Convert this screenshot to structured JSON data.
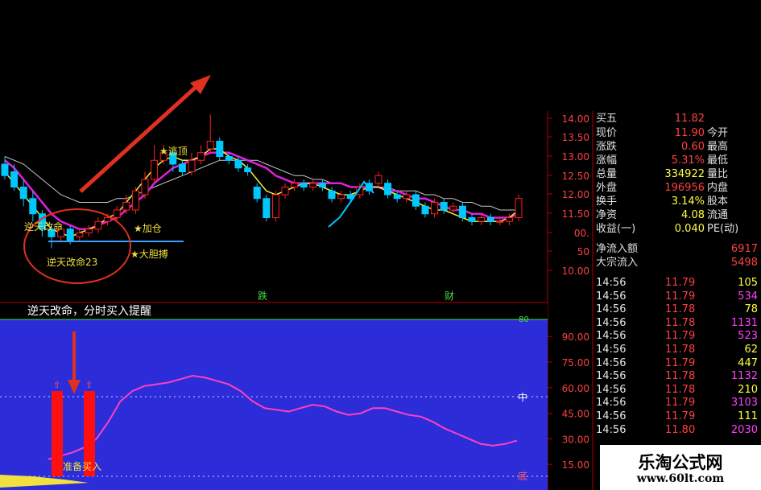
{
  "chart_data": [
    {
      "type": "candlestick",
      "ylim": [
        10.0,
        14.0
      ],
      "y_ticks": [
        "14.00",
        "13.50",
        "13.00",
        "12.50",
        "12.00",
        "11.50",
        "00.",
        "50",
        "10.00"
      ],
      "x_markers": [
        "跌",
        "财"
      ],
      "signal_labels": [
        "逆天改命",
        "逆天改命23",
        "加仓",
        "大胆搏",
        "逃顶"
      ],
      "candles": [
        {
          "o": 12.8,
          "c": 12.5,
          "h": 13.0,
          "l": 12.4
        },
        {
          "o": 12.6,
          "c": 12.2,
          "h": 12.8,
          "l": 12.1
        },
        {
          "o": 12.2,
          "c": 11.9,
          "h": 12.4,
          "l": 11.7
        },
        {
          "o": 11.9,
          "c": 11.5,
          "h": 12.1,
          "l": 11.3
        },
        {
          "o": 11.5,
          "c": 11.1,
          "h": 11.6,
          "l": 10.9
        },
        {
          "o": 11.1,
          "c": 10.9,
          "h": 11.2,
          "l": 10.6
        },
        {
          "o": 10.9,
          "c": 11.1,
          "h": 11.2,
          "l": 10.8
        },
        {
          "o": 11.1,
          "c": 10.8,
          "h": 11.2,
          "l": 10.7
        },
        {
          "o": 10.9,
          "c": 11.0,
          "h": 11.1,
          "l": 10.8
        },
        {
          "o": 11.0,
          "c": 11.1,
          "h": 11.2,
          "l": 10.9
        },
        {
          "o": 11.1,
          "c": 11.3,
          "h": 11.4,
          "l": 11.0
        },
        {
          "o": 11.3,
          "c": 11.4,
          "h": 11.5,
          "l": 11.2
        },
        {
          "o": 11.4,
          "c": 11.6,
          "h": 11.7,
          "l": 11.3
        },
        {
          "o": 11.6,
          "c": 11.8,
          "h": 12.0,
          "l": 11.5
        },
        {
          "o": 11.6,
          "c": 12.1,
          "h": 12.2,
          "l": 11.5
        },
        {
          "o": 12.0,
          "c": 12.4,
          "h": 12.6,
          "l": 11.9
        },
        {
          "o": 12.4,
          "c": 12.9,
          "h": 13.3,
          "l": 12.3
        },
        {
          "o": 12.9,
          "c": 13.1,
          "h": 13.3,
          "l": 12.8
        },
        {
          "o": 13.1,
          "c": 12.8,
          "h": 13.2,
          "l": 12.6
        },
        {
          "o": 12.8,
          "c": 12.6,
          "h": 12.9,
          "l": 12.5
        },
        {
          "o": 12.6,
          "c": 12.9,
          "h": 13.1,
          "l": 12.5
        },
        {
          "o": 12.9,
          "c": 13.1,
          "h": 13.3,
          "l": 12.8
        },
        {
          "o": 13.2,
          "c": 13.4,
          "h": 14.1,
          "l": 13.1
        },
        {
          "o": 13.4,
          "c": 13.0,
          "h": 13.5,
          "l": 12.9
        },
        {
          "o": 13.0,
          "c": 12.9,
          "h": 13.1,
          "l": 12.8
        },
        {
          "o": 12.9,
          "c": 12.7,
          "h": 13.0,
          "l": 12.6
        },
        {
          "o": 12.7,
          "c": 12.6,
          "h": 12.8,
          "l": 12.5
        },
        {
          "o": 12.2,
          "c": 11.9,
          "h": 12.3,
          "l": 11.8
        },
        {
          "o": 11.9,
          "c": 11.4,
          "h": 12.0,
          "l": 11.3
        },
        {
          "o": 11.4,
          "c": 12.0,
          "h": 12.1,
          "l": 11.3
        },
        {
          "o": 12.0,
          "c": 12.2,
          "h": 12.3,
          "l": 11.9
        },
        {
          "o": 12.2,
          "c": 12.3,
          "h": 12.4,
          "l": 12.1
        },
        {
          "o": 12.3,
          "c": 12.2,
          "h": 12.4,
          "l": 12.1
        },
        {
          "o": 12.2,
          "c": 12.3,
          "h": 12.4,
          "l": 12.1
        },
        {
          "o": 12.3,
          "c": 12.2,
          "h": 12.4,
          "l": 12.1
        },
        {
          "o": 12.1,
          "c": 11.9,
          "h": 12.2,
          "l": 11.8
        },
        {
          "o": 11.9,
          "c": 12.0,
          "h": 12.1,
          "l": 11.8
        },
        {
          "o": 12.0,
          "c": 11.9,
          "h": 12.1,
          "l": 11.8
        },
        {
          "o": 12.0,
          "c": 12.2,
          "h": 12.3,
          "l": 11.9
        },
        {
          "o": 12.3,
          "c": 12.1,
          "h": 12.4,
          "l": 12.0
        },
        {
          "o": 12.3,
          "c": 12.5,
          "h": 12.6,
          "l": 12.2
        },
        {
          "o": 12.3,
          "c": 12.0,
          "h": 12.4,
          "l": 11.9
        },
        {
          "o": 12.0,
          "c": 11.9,
          "h": 12.1,
          "l": 11.8
        },
        {
          "o": 11.9,
          "c": 12.0,
          "h": 12.1,
          "l": 11.8
        },
        {
          "o": 12.0,
          "c": 11.7,
          "h": 12.1,
          "l": 11.6
        },
        {
          "o": 11.7,
          "c": 11.5,
          "h": 11.8,
          "l": 11.4
        },
        {
          "o": 11.5,
          "c": 11.8,
          "h": 11.9,
          "l": 11.4
        },
        {
          "o": 11.8,
          "c": 11.6,
          "h": 11.9,
          "l": 11.5
        },
        {
          "o": 11.6,
          "c": 11.7,
          "h": 11.8,
          "l": 11.5
        },
        {
          "o": 11.7,
          "c": 11.4,
          "h": 11.8,
          "l": 11.3
        },
        {
          "o": 11.4,
          "c": 11.3,
          "h": 11.5,
          "l": 11.2
        },
        {
          "o": 11.3,
          "c": 11.4,
          "h": 11.5,
          "l": 11.2
        },
        {
          "o": 11.4,
          "c": 11.3,
          "h": 11.5,
          "l": 11.2
        },
        {
          "o": 11.3,
          "c": 11.3,
          "h": 11.4,
          "l": 11.2
        },
        {
          "o": 11.3,
          "c": 11.4,
          "h": 11.5,
          "l": 11.2
        },
        {
          "o": 11.4,
          "c": 11.9,
          "h": 12.0,
          "l": 11.3
        }
      ],
      "series": [
        {
          "values": [
            13.0,
            12.9,
            12.8,
            12.6,
            12.4,
            12.2,
            12.0,
            11.9,
            11.8,
            11.8,
            11.8,
            11.8,
            11.9,
            11.9,
            12.0,
            12.1,
            12.2,
            12.3,
            12.4,
            12.5,
            12.6,
            12.7,
            12.8,
            12.9,
            12.9,
            12.9,
            12.9,
            12.9,
            12.8,
            12.7,
            12.6,
            12.5,
            12.5,
            12.4,
            12.4,
            12.3,
            12.3,
            12.2,
            12.2,
            12.2,
            12.2,
            12.2,
            12.1,
            12.1,
            12.1,
            12.0,
            12.0,
            11.9,
            11.9,
            11.8,
            11.8,
            11.7,
            11.7,
            11.6,
            11.6,
            11.6
          ]
        },
        {
          "values": [
            12.9,
            12.7,
            12.4,
            12.1,
            11.8,
            11.5,
            11.3,
            11.2,
            11.1,
            11.1,
            11.2,
            11.3,
            11.4,
            11.6,
            11.8,
            12.0,
            12.3,
            12.5,
            12.7,
            12.8,
            12.9,
            13.0,
            13.1,
            13.1,
            13.1,
            13.0,
            12.9,
            12.8,
            12.7,
            12.5,
            12.4,
            12.3,
            12.3,
            12.3,
            12.3,
            12.3,
            12.3,
            12.2,
            12.2,
            12.2,
            12.2,
            12.1,
            12.1,
            12.0,
            11.9,
            11.9,
            11.8,
            11.7,
            11.6,
            11.6,
            11.5,
            11.5,
            11.4,
            11.4,
            11.4,
            11.5
          ]
        },
        {
          "values": [
            12.6,
            12.3,
            12.0,
            11.7,
            11.4,
            11.1,
            11.0,
            10.9,
            11.0,
            11.1,
            11.2,
            11.4,
            11.5,
            11.8,
            12.1,
            12.4,
            12.7,
            12.9,
            13.0,
            12.9,
            12.9,
            13.0,
            13.2,
            13.2,
            13.0,
            12.9,
            12.7,
            12.4,
            12.1,
            12.0,
            12.1,
            12.2,
            12.3,
            12.3,
            12.2,
            12.1,
            12.0,
            12.0,
            12.1,
            12.2,
            12.2,
            12.1,
            12.0,
            11.9,
            11.8,
            11.7,
            11.6,
            11.6,
            11.5,
            11.4,
            11.3,
            11.3,
            11.3,
            11.3,
            11.4,
            11.6
          ]
        }
      ]
    },
    {
      "type": "line",
      "ylim": [
        0,
        100
      ],
      "y_ticks": [
        "90.00",
        "75.00",
        "60.00",
        "45.00",
        "30.00",
        "15.00"
      ],
      "reference_labels": [
        "中",
        "底",
        "80"
      ],
      "series": [
        {
          "values": [
            18,
            20,
            22,
            25,
            30,
            40,
            52,
            58,
            61,
            62,
            63,
            65,
            67,
            66,
            64,
            62,
            58,
            52,
            48,
            47,
            46,
            48,
            50,
            49,
            46,
            44,
            45,
            48,
            48,
            46,
            44,
            43,
            40,
            36,
            33,
            30,
            27,
            26,
            27,
            29
          ]
        }
      ],
      "bars": [
        {
          "x_index": 2,
          "value": 58
        },
        {
          "x_index": 4,
          "value": 58
        }
      ],
      "bar_marker_labels": [
        "准备买入"
      ]
    }
  ],
  "bottom_title": "逆天改命，分时买入提醒",
  "quote_panel": {
    "header": {
      "label": "买五",
      "value": "11.82"
    },
    "rows": [
      {
        "label": "现价",
        "value": "11.90",
        "label2": "今开",
        "color": "#ff4040"
      },
      {
        "label": "涨跌",
        "value": "0.60",
        "label2": "最高",
        "color": "#ff4040"
      },
      {
        "label": "涨幅",
        "value": "5.31%",
        "label2": "最低",
        "color": "#ff4040"
      },
      {
        "label": "总量",
        "value": "334922",
        "label2": "量比",
        "color": "#ffff40"
      },
      {
        "label": "外盘",
        "value": "196956",
        "label2": "内盘",
        "color": "#ff4040"
      },
      {
        "label": "换手",
        "value": "3.14%",
        "label2": "股本",
        "color": "#ffff40"
      },
      {
        "label": "净资",
        "value": "4.08",
        "label2": "流通",
        "color": "#ffff40"
      },
      {
        "label": "收益(一)",
        "value": "0.040",
        "label2": "PE(动)",
        "color": "#ffff40"
      }
    ],
    "flow": [
      {
        "label": "净流入额",
        "value": "6917"
      },
      {
        "label": "大宗流入",
        "value": "5498"
      }
    ],
    "ticks": [
      {
        "time": "14:56",
        "price": "11.79",
        "vol": "105",
        "c": "#ffff40"
      },
      {
        "time": "14:56",
        "price": "11.79",
        "vol": "534",
        "c": "#ff40ff"
      },
      {
        "time": "14:56",
        "price": "11.78",
        "vol": "78",
        "c": "#ffff40"
      },
      {
        "time": "14:56",
        "price": "11.78",
        "vol": "1131",
        "c": "#ff40ff"
      },
      {
        "time": "14:56",
        "price": "11.79",
        "vol": "523",
        "c": "#ff40ff"
      },
      {
        "time": "14:56",
        "price": "11.78",
        "vol": "62",
        "c": "#ffff40"
      },
      {
        "time": "14:56",
        "price": "11.79",
        "vol": "447",
        "c": "#ffff40"
      },
      {
        "time": "14:56",
        "price": "11.78",
        "vol": "1132",
        "c": "#ff40ff"
      },
      {
        "time": "14:56",
        "price": "11.78",
        "vol": "210",
        "c": "#ffff40"
      },
      {
        "time": "14:56",
        "price": "11.79",
        "vol": "3103",
        "c": "#ff40ff"
      },
      {
        "time": "14:56",
        "price": "11.79",
        "vol": "111",
        "c": "#ffff40"
      },
      {
        "time": "14:56",
        "price": "11.80",
        "vol": "2030",
        "c": "#ff40ff"
      }
    ]
  },
  "watermark": {
    "name": "乐淘公式网",
    "url": "www.60lt.com"
  },
  "colors": {
    "up": "#ff2020",
    "down": "#00c8ff",
    "ma_slow": "#c8c8c8",
    "ma_mid": "#e020e0",
    "ma_fast": "#f0f040",
    "osc_bg": "#2c2cd8",
    "osc_line": "#ff40c0",
    "axis": "#b00000"
  }
}
